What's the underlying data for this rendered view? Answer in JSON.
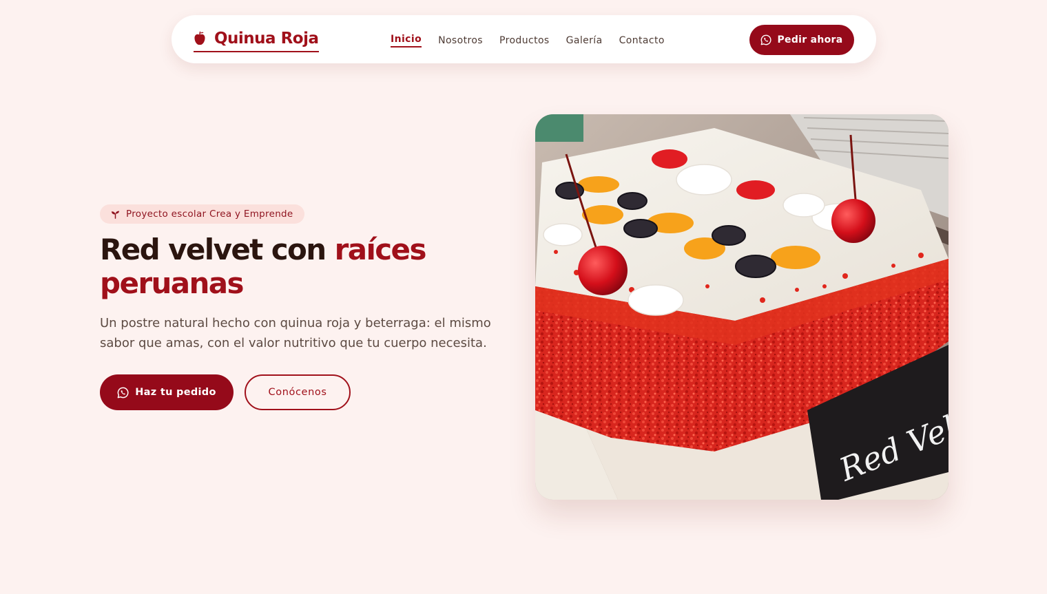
{
  "header": {
    "brand": {
      "name": "Quinua Roja",
      "icon": "apple-icon"
    },
    "nav": [
      {
        "label": "Inicio",
        "active": true
      },
      {
        "label": "Nosotros",
        "active": false
      },
      {
        "label": "Productos",
        "active": false
      },
      {
        "label": "Galería",
        "active": false
      },
      {
        "label": "Contacto",
        "active": false
      }
    ],
    "order_button": {
      "label": "Pedir ahora",
      "icon": "whatsapp-icon"
    }
  },
  "hero": {
    "badge": {
      "label": "Proyecto escolar Crea y Emprende",
      "icon": "sprout-icon"
    },
    "title_main": "Red velvet con ",
    "title_accent": "raíces peruanas",
    "description": "Un postre natural hecho con quinua roja y beterraga: el mismo sabor que amas, con el valor nutritivo que tu cuerpo necesita.",
    "primary_cta": {
      "label": "Haz tu pedido",
      "icon": "whatsapp-icon"
    },
    "secondary_cta": {
      "label": "Conócenos"
    },
    "image": {
      "sign_text": "Red Velv"
    }
  },
  "colors": {
    "brand": "#a0101a",
    "button": "#950a1a",
    "background": "#fdf2f0",
    "badge_bg": "#fbe0dc",
    "heading": "#2b150f"
  }
}
